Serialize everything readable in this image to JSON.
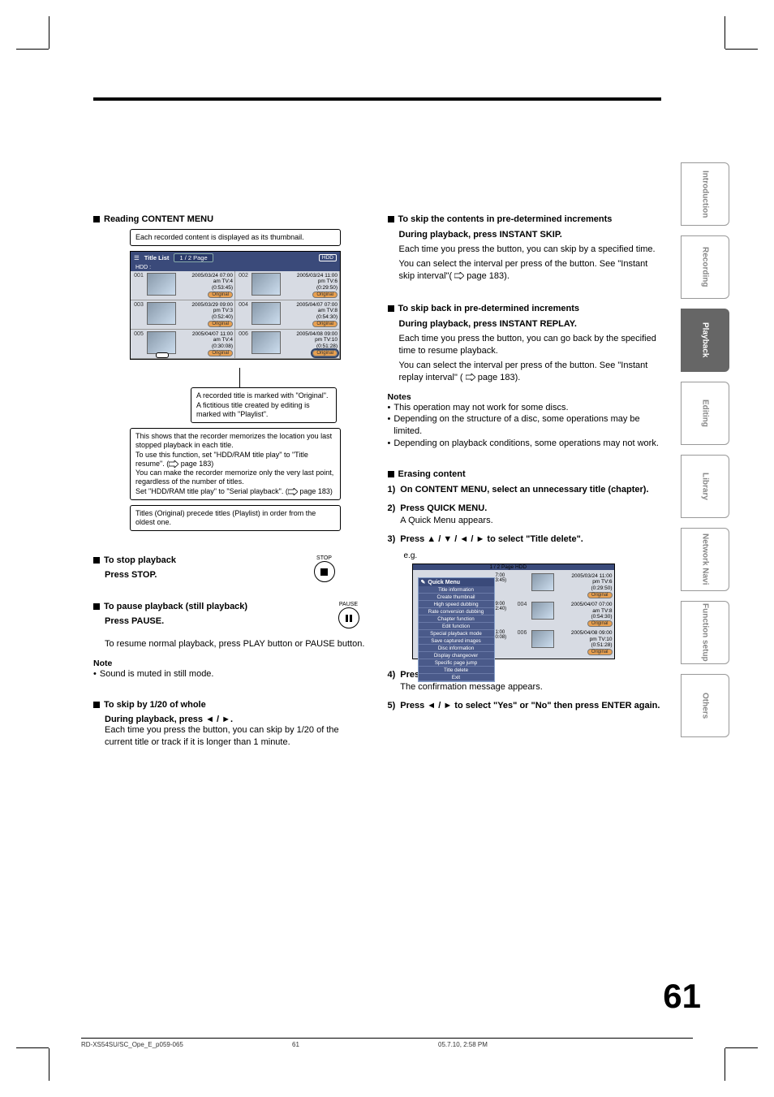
{
  "page_number": "61",
  "footer": {
    "file": "RD-XS54SU/SC_Ope_E_p059-065",
    "page": "61",
    "timestamp": "05.7.10, 2:58 PM"
  },
  "side_tabs": [
    "Introduction",
    "Recording",
    "Playback",
    "Editing",
    "Library",
    "Network Navi",
    "Function setup",
    "Others"
  ],
  "left": {
    "section1_title": "Reading CONTENT MENU",
    "callout_thumb": "Each recorded content is displayed as its thumbnail.",
    "menu": {
      "title_list": "Title List",
      "page": "1 / 2  Page",
      "hdd": "HDD",
      "hdd_sub": "HDD :",
      "items": [
        {
          "n": "001",
          "date": "2005/03/24 07:00",
          "ch": "am  TV:4",
          "dur": "(0:53:45)",
          "tag": "Original"
        },
        {
          "n": "002",
          "date": "2005/03/24 11:00",
          "ch": "pm  TV:6",
          "dur": "(0:29:50)",
          "tag": "Original"
        },
        {
          "n": "003",
          "date": "2005/03/29 09:00",
          "ch": "pm  TV:3",
          "dur": "(0:52:40)",
          "tag": "Original"
        },
        {
          "n": "004",
          "date": "2005/04/07 07:00",
          "ch": "am  TV:8",
          "dur": "(0:54:30)",
          "tag": "Original"
        },
        {
          "n": "005",
          "date": "2005/04/07 11:00",
          "ch": "am  TV:4",
          "dur": "(0:30:08)",
          "tag": "Original"
        },
        {
          "n": "006",
          "date": "2005/04/08 09:00",
          "ch": "pm  TV:10",
          "dur": "(0:51:28)",
          "tag": "Original"
        }
      ]
    },
    "callout_original": "A recorded title is marked with \"Original\". A fictitious title created by editing is marked with \"Playlist\".",
    "callout_resume": "This shows that the recorder memorizes the location you last stopped playback in each title.\nTo use this function, set \"HDD/RAM title play\" to \"Title resume\". ( page 183)\nYou can make the recorder memorize only the very last point, regardless of the number of titles.\nSet \"HDD/RAM title play\" to \"Serial playback\". ( page 183)",
    "callout_order": "Titles (Original) precede titles (Playlist) in order from the oldest one.",
    "stop_title": "To stop playback",
    "stop_cmd": "Press STOP.",
    "stop_label": "STOP",
    "pause_title": "To pause playback (still playback)",
    "pause_cmd": "Press PAUSE.",
    "pause_label": "PAUSE",
    "pause_resume": "To resume normal playback, press PLAY button or PAUSE button.",
    "note_head": "Note",
    "note_text": "Sound is muted in still mode.",
    "skip20_title": "To skip by 1/20 of whole",
    "skip20_cmd": "During playback, press ◄ / ►.",
    "skip20_text": "Each time you press the button, you can skip by 1/20 of the current title or track if it is longer than 1 minute."
  },
  "right": {
    "skipf_title": "To skip the contents in pre-determined increments",
    "skipf_cmd": "During playback, press INSTANT SKIP.",
    "skipf_t1": "Each time you press the button, you can skip by a specified time.",
    "skipf_t2a": "You can select the interval per press of the button. See \"Instant skip interval\"(",
    "skipf_t2b": " page 183).",
    "skipb_title": "To skip back in pre-determined increments",
    "skipb_cmd": "During playback, press INSTANT REPLAY.",
    "skipb_t1": "Each time you press the button, you can go back by the specified time to resume playback.",
    "skipb_t2a": "You can select the interval per press of the button. See \"Instant replay interval\" (",
    "skipb_t2b": " page 183).",
    "notes_head": "Notes",
    "notes": [
      "This operation may not work for some discs.",
      "Depending on the structure of a disc, some operations may be limited.",
      "Depending on playback conditions, some operations may not work."
    ],
    "erase_title": "Erasing content",
    "steps": {
      "s1": "On CONTENT MENU, select an unnecessary title (chapter).",
      "s2a": "Press QUICK MENU.",
      "s2b": "A Quick Menu appears.",
      "s3": "Press ▲ / ▼ / ◄ / ► to select \"Title delete\".",
      "s4a": "Press ENTER.",
      "s4b": "The confirmation message appears.",
      "s5": "Press ◄ / ► to select \"Yes\" or \"No\" then press ENTER again."
    },
    "eg_label": "e.g.",
    "quick_menu": {
      "title": "Quick Menu",
      "items": [
        "Title information",
        "Create thumbnail",
        "High speed dubbing",
        "Rate conversion dubbing",
        "Chapter function",
        "Edit function",
        "Special playback mode",
        "Save captured images",
        "Disc information",
        "Display changeover",
        "Specific page jump",
        "Title delete",
        "Exit"
      ]
    },
    "eg_right_items": [
      {
        "t": "7:00",
        "date": "2005/03/24 11:00",
        "ch": "pm  TV:6",
        "dur": "(0:29:50)",
        "tag": "Original",
        "ext": "3:45)"
      },
      {
        "t": "9:00",
        "n": "004",
        "date": "2005/04/07 07:00",
        "ch": "am  TV:8",
        "dur": "(0:54:30)",
        "tag": "Original",
        "ext": "2:40)"
      },
      {
        "t": "1:00",
        "n": "006",
        "date": "2005/04/08 09:00",
        "ch": "pm  TV:10",
        "dur": "(0:51:28)",
        "tag": "Original",
        "ext": "0:08)"
      }
    ],
    "eg_page": "1 / 2  Page",
    "eg_hdd": "HDD"
  }
}
